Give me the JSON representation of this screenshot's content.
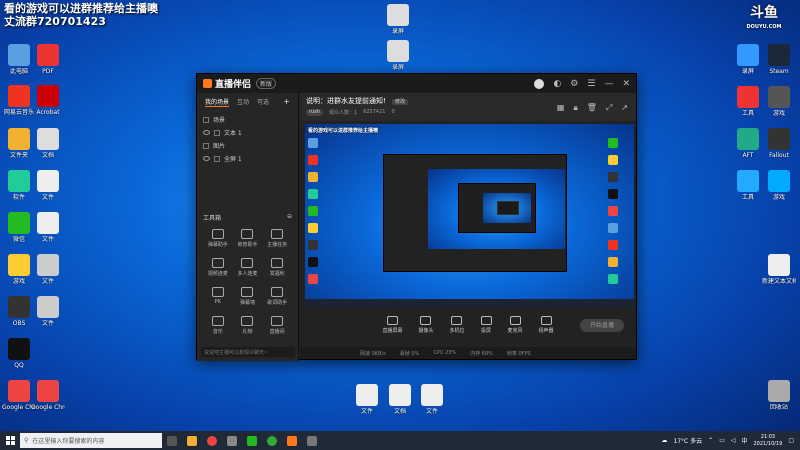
{
  "overlay": {
    "line1": "看的游戏可以进群推荐给主播噢",
    "line2": "丈流群720701423"
  },
  "watermark": {
    "logo": "斗鱼",
    "sub": "DOUYU.COM"
  },
  "desktop_left": [
    {
      "label": "此电脑",
      "color": "#5aa0e0"
    },
    {
      "label": "PDF",
      "color": "#e33"
    },
    {
      "label": "网易云音乐",
      "color": "#e32"
    },
    {
      "label": "Acrobat",
      "color": "#c00"
    },
    {
      "label": "文件夹",
      "color": "#f2b133"
    },
    {
      "label": "文档",
      "color": "#ddd"
    },
    {
      "label": "软件",
      "color": "#2c9"
    },
    {
      "label": "文件",
      "color": "#eee"
    },
    {
      "label": "微信",
      "color": "#2b2"
    },
    {
      "label": "文件",
      "color": "#eee"
    },
    {
      "label": "游戏",
      "color": "#fc3"
    },
    {
      "label": "文件",
      "color": "#ccc"
    },
    {
      "label": "OBS",
      "color": "#333"
    },
    {
      "label": "文件",
      "color": "#ccc"
    },
    {
      "label": "QQ",
      "color": "#111"
    },
    {
      "label": "Google Chrome",
      "color": "#e44"
    },
    {
      "label": "Google Chrome",
      "color": "#e44"
    }
  ],
  "desktop_right": [
    {
      "label": "录屏",
      "color": "#3399ff"
    },
    {
      "label": "Steam",
      "color": "#1b2838"
    },
    {
      "label": "工具",
      "color": "#e33"
    },
    {
      "label": "游戏",
      "color": "#555"
    },
    {
      "label": "AFT",
      "color": "#2a8"
    },
    {
      "label": "Fallout",
      "color": "#333"
    },
    {
      "label": "工具",
      "color": "#2af"
    },
    {
      "label": "游戏",
      "color": "#0af"
    },
    {
      "label": "新建文本文档",
      "color": "#eee"
    },
    {
      "label": "回收站",
      "color": "#aaa"
    }
  ],
  "desktop_center": [
    {
      "label": "录屏",
      "color": "#ddd"
    },
    {
      "label": "录屏",
      "color": "#ddd"
    }
  ],
  "desktop_bottom": [
    {
      "label": "文件",
      "color": "#eee"
    },
    {
      "label": "文档",
      "color": "#eee"
    },
    {
      "label": "文件",
      "color": "#eee"
    }
  ],
  "app": {
    "brand": "直播伴侣",
    "version": "新版",
    "tabs": [
      "我的场景",
      "互动",
      "可选"
    ],
    "scenes": [
      "场景",
      "文本 1",
      "图片",
      "全屏 1"
    ],
    "tools_title": "工具箱",
    "tools": [
      "弹幕助手",
      "房管助手",
      "主播任务",
      "视频连麦",
      "多人连麦",
      "发福利",
      "PK",
      "弹幕墙",
      "歌词助手",
      "音乐",
      "礼物",
      "直播间"
    ],
    "chat_placeholder": "说说吧主播可以和观众聊天~",
    "notice": "说明：进群水友提前通知!",
    "notice_tag": "修改",
    "room_tag": "rush",
    "room_stats": [
      "观众人数：1",
      "6257421",
      "0"
    ],
    "preview_overlay": "看的游戏可以进群推荐给主播噢",
    "controls": [
      "直播屏幕",
      "摄像头",
      "多机位",
      "投屏",
      "麦克风",
      "扬声器"
    ],
    "start_label": "开始直播",
    "status": [
      "网速 0KB/s",
      "丢帧 0%",
      "CPU 23%",
      "内存 68%",
      "帧率 0FPS"
    ]
  },
  "taskbar": {
    "search_placeholder": "在这里输入你要搜索的内容",
    "temperature": "17°C 多云",
    "time": "21:03",
    "date": "2021/10/19"
  }
}
